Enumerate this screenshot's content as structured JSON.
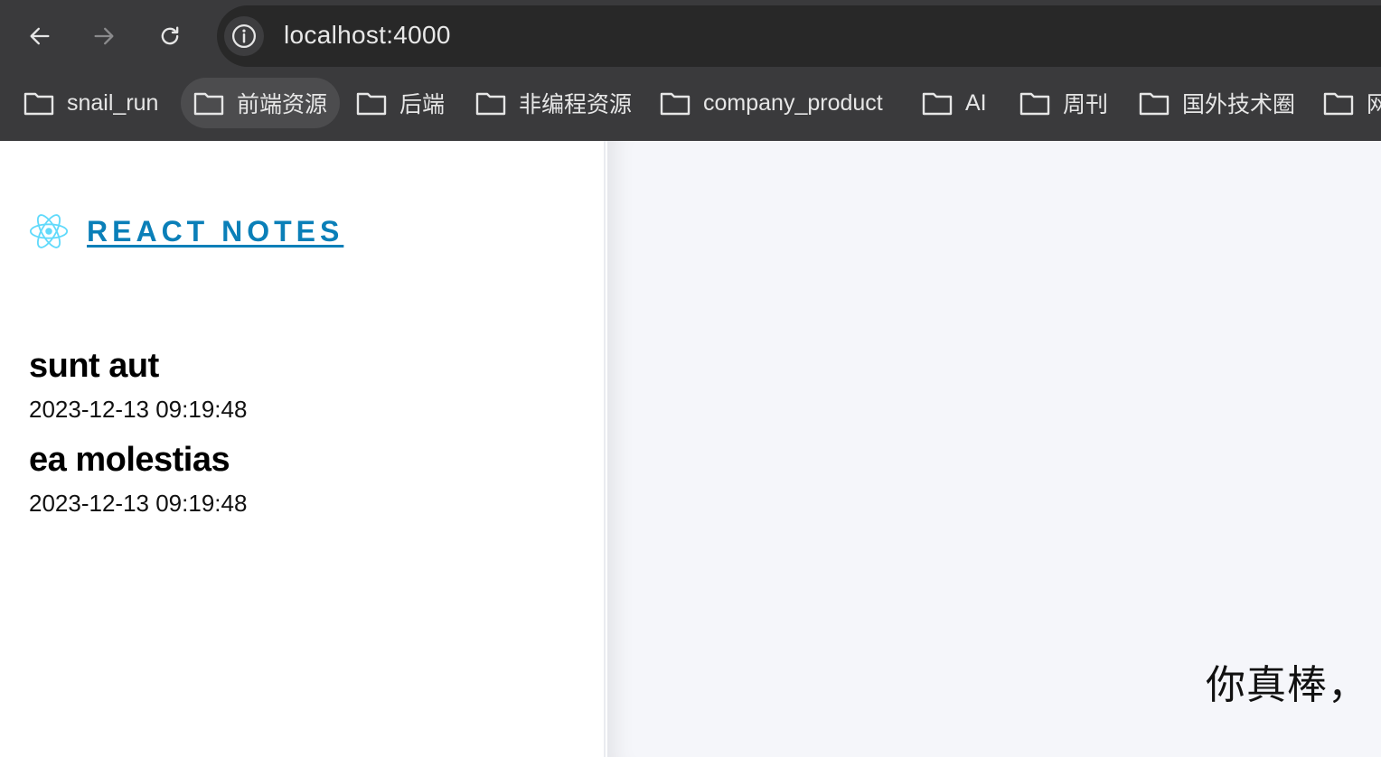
{
  "browser": {
    "url": "localhost:4000",
    "bookmarks": [
      {
        "label": "snail_run",
        "active": false
      },
      {
        "label": "前端资源",
        "active": true
      },
      {
        "label": "后端",
        "active": false
      },
      {
        "label": "非编程资源",
        "active": false
      },
      {
        "label": "company_product",
        "active": false
      },
      {
        "label": "AI",
        "active": false
      },
      {
        "label": "周刊",
        "active": false
      },
      {
        "label": "国外技术圈",
        "active": false
      },
      {
        "label": "网",
        "active": false
      }
    ]
  },
  "sidebar": {
    "brand_label": "REACT NOTES",
    "notes": [
      {
        "title": "sunt aut",
        "date": "2023-12-13 09:19:48"
      },
      {
        "title": "ea molestias",
        "date": "2023-12-13 09:19:48"
      }
    ]
  },
  "main": {
    "message": "你真棒，"
  }
}
